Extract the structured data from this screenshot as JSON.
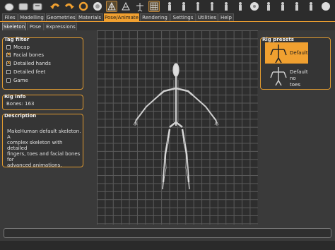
{
  "toolbar": {
    "icons": [
      "new-file-icon",
      "save-icon",
      "export-icon",
      "undo-icon",
      "redo-icon",
      "reset-icon",
      "smooth-icon",
      "wireframe-icon",
      "background-icon",
      "pose-icon",
      "grid-icon",
      "front-view-icon",
      "back-view-icon",
      "left-view-icon",
      "right-view-icon",
      "top-view-icon",
      "bottom-view-icon",
      "reset-camera-icon"
    ]
  },
  "tabs": [
    "Files",
    "Modelling",
    "Geometries",
    "Materials",
    "Pose/Animate",
    "Rendering",
    "Settings",
    "Utilities",
    "Help"
  ],
  "active_tab": "Pose/Animate",
  "subtabs": [
    "Skeleton",
    "Pose",
    "Expressions"
  ],
  "active_subtab": "Skeleton",
  "tag_filter": {
    "title": "Tag filter",
    "items": [
      {
        "label": "Mocap",
        "checked": false
      },
      {
        "label": "Facial bones",
        "checked": true
      },
      {
        "label": "Detailed hands",
        "checked": true
      },
      {
        "label": "Detailed feet",
        "checked": false
      },
      {
        "label": "Game",
        "checked": false
      }
    ]
  },
  "rig_info": {
    "title": "Rig info",
    "bones": "Bones: 163"
  },
  "description": {
    "title": "Description",
    "lines": [
      "MakeHuman default skeleton. A",
      "complex skeleton with detailed",
      "fingers, toes and facial bones for",
      "advanced animations."
    ]
  },
  "rig_presets": {
    "title": "Rig presets",
    "items": [
      {
        "label_lines": [
          "Default"
        ],
        "selected": true
      },
      {
        "label_lines": [
          "Default no",
          "toes"
        ],
        "selected": false
      }
    ]
  },
  "colors": {
    "accent": "#f0a030",
    "background": "#3a3a3a",
    "panel_border": "#e09a30"
  }
}
